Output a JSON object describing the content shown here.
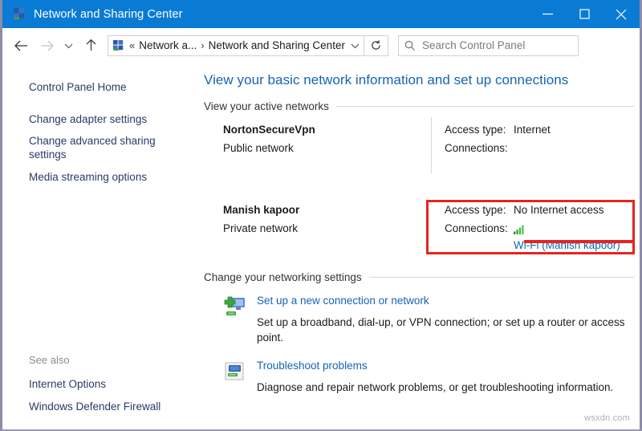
{
  "window": {
    "title": "Network and Sharing Center",
    "app_icon": "network-icon",
    "controls": {
      "minimize": "minimize-icon",
      "maximize": "maximize-icon",
      "close": "close-icon"
    },
    "titlebar_color": "#0a7bd4"
  },
  "toolbar": {
    "back": "back-arrow-icon",
    "forward": "forward-arrow-icon",
    "recent": "recent-chevron-icon",
    "up": "up-arrow-icon",
    "breadcrumb": {
      "icon": "network-icon",
      "separator_prefix": "«",
      "segment1": "Network a...",
      "segment_sep": "›",
      "segment2": "Network and Sharing Center",
      "dropdown": "chevron-down-icon"
    },
    "refresh": "refresh-icon",
    "search": {
      "icon": "search-icon",
      "placeholder": "Search Control Panel",
      "value": ""
    }
  },
  "sidebar": {
    "home": "Control Panel Home",
    "items": [
      "Change adapter settings",
      "Change advanced sharing settings",
      "Media streaming options"
    ],
    "see_also_label": "See also",
    "see_also": [
      "Internet Options",
      "Windows Defender Firewall"
    ]
  },
  "main": {
    "page_title": "View your basic network information and set up connections",
    "sections": {
      "active_networks": "View your active networks",
      "change_settings": "Change your networking settings"
    },
    "networks": [
      {
        "name": "NortonSecureVpn",
        "type": "Public network",
        "access_label": "Access type:",
        "access_value": "Internet",
        "connections_label": "Connections:",
        "connections_value": "",
        "highlighted": false
      },
      {
        "name": "Manish kapoor",
        "type": "Private network",
        "access_label": "Access type:",
        "access_value": "No Internet access",
        "connections_label": "Connections:",
        "connections_value": "Wi-Fi (Manish kapoor)",
        "connections_icon": "wifi-signal-icon",
        "highlighted": true
      }
    ],
    "tasks": [
      {
        "icon": "new-connection-icon",
        "link": "Set up a new connection or network",
        "description": "Set up a broadband, dial-up, or VPN connection; or set up a router or access point."
      },
      {
        "icon": "troubleshoot-icon",
        "link": "Troubleshoot problems",
        "description": "Diagnose and repair network problems, or get troubleshooting information."
      }
    ]
  },
  "annotation": {
    "highlight_color": "#e52421"
  },
  "watermark": "wsxdn.com"
}
